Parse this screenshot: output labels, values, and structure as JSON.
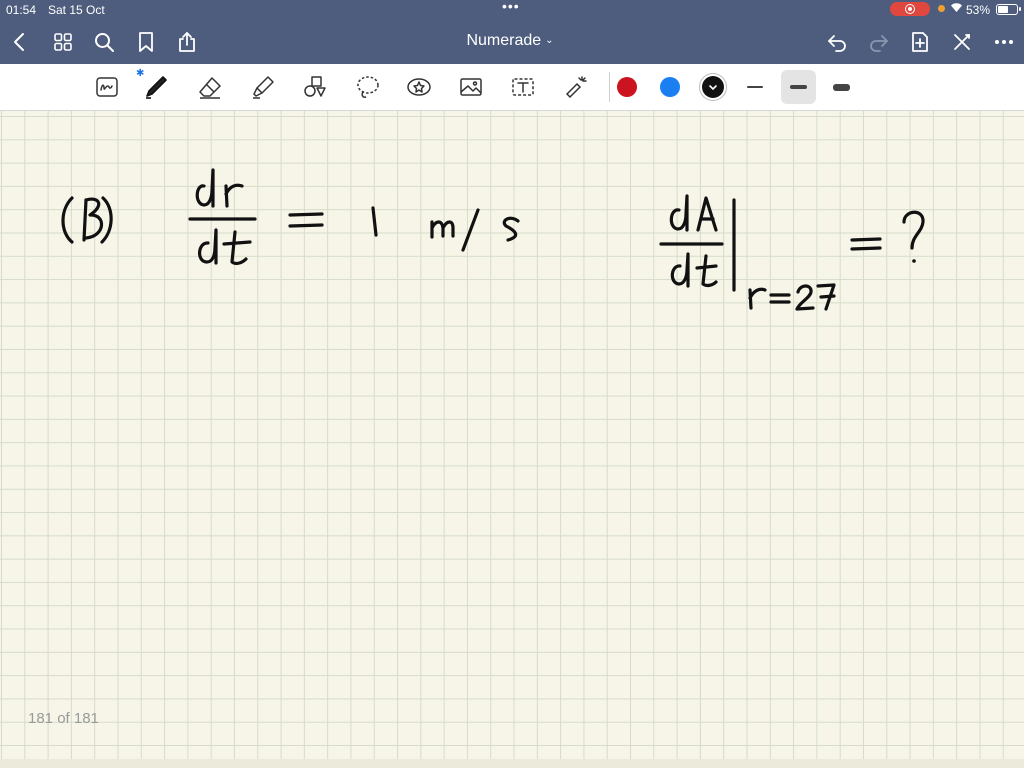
{
  "status": {
    "time": "01:54",
    "date": "Sat 15 Oct",
    "battery": "53%",
    "battery_level": 0.53
  },
  "nav": {
    "title": "Numerade",
    "icons": [
      "back-icon",
      "grid-icon",
      "search-icon",
      "bookmark-icon",
      "share-icon",
      "undo-icon",
      "redo-icon",
      "add-page-icon",
      "close-icon",
      "more-icon"
    ]
  },
  "toolbar": {
    "tools": [
      "handwriting-to-text",
      "pen",
      "eraser",
      "highlighter",
      "shapes",
      "lasso",
      "sticker",
      "image",
      "text",
      "laser-pointer"
    ],
    "colors": [
      "#cc1421",
      "#1a7ff0",
      "#111111"
    ],
    "selected_color": "#111111",
    "stroke_widths": [
      "thin",
      "medium",
      "thick"
    ],
    "selected_stroke": "medium"
  },
  "page": {
    "counter": "181 of 181",
    "handwriting": "(B)  dr/dt = 1 m/s     dA/dt |r=27 = ?"
  }
}
